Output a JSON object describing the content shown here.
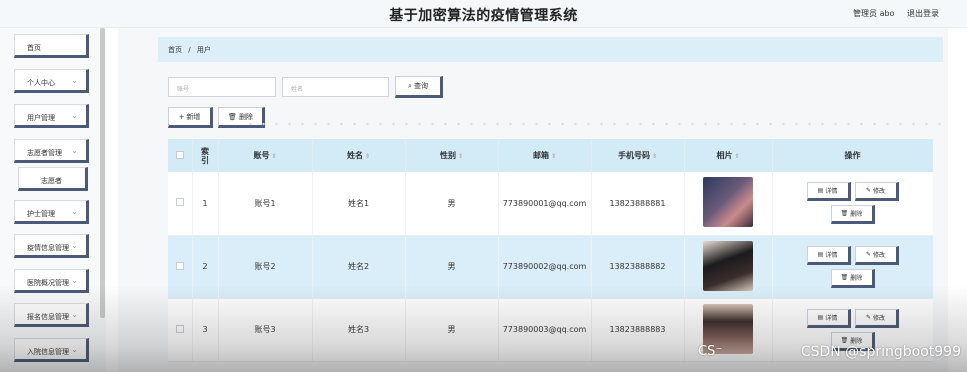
{
  "header": {
    "title": "基于加密算法的疫情管理系统",
    "user_label": "管理员 abo",
    "logout_label": "退出登录"
  },
  "sidebar": {
    "items": [
      {
        "label": "首页",
        "chevron": ""
      },
      {
        "label": "个人中心",
        "chevron": "⌄"
      },
      {
        "label": "用户管理",
        "chevron": "⌄"
      },
      {
        "label": "志愿者管理",
        "chevron": "⌄"
      },
      {
        "label": "志愿者",
        "chevron": ""
      },
      {
        "label": "护士管理",
        "chevron": "⌄"
      },
      {
        "label": "疫情信息管理",
        "chevron": "⌄"
      },
      {
        "label": "医院概况管理",
        "chevron": "⌄"
      },
      {
        "label": "报名信息管理",
        "chevron": "⌄"
      },
      {
        "label": "入院信息管理",
        "chevron": "⌄"
      }
    ]
  },
  "breadcrumb": {
    "home": "首页",
    "sep": "/",
    "current": "用户"
  },
  "search": {
    "account_placeholder": "账号",
    "name_placeholder": "姓名",
    "button_label": "查询"
  },
  "actions": {
    "add_label": "新增",
    "delete_label": "删除"
  },
  "table": {
    "headers": {
      "index": "索引",
      "account": "账号",
      "name": "姓名",
      "gender": "性别",
      "email": "邮箱",
      "phone": "手机号码",
      "photo": "相片",
      "ops": "操作"
    },
    "op_labels": {
      "detail": "详情",
      "edit": "修改",
      "delete": "删除"
    },
    "rows": [
      {
        "index": "1",
        "account": "账号1",
        "name": "姓名1",
        "gender": "男",
        "email": "773890001@qq.com",
        "phone": "13823888881"
      },
      {
        "index": "2",
        "account": "账号2",
        "name": "姓名2",
        "gender": "男",
        "email": "773890002@qq.com",
        "phone": "13823888882"
      },
      {
        "index": "3",
        "account": "账号3",
        "name": "姓名3",
        "gender": "男",
        "email": "773890003@qq.com",
        "phone": "13823888883"
      }
    ]
  },
  "watermark": {
    "text": "CSDN @springboot999",
    "logo": "CS⁻"
  },
  "colors": {
    "accent": "#4a5a78",
    "header_bg": "#d3ebf7",
    "row_alt": "#d9eef8"
  }
}
